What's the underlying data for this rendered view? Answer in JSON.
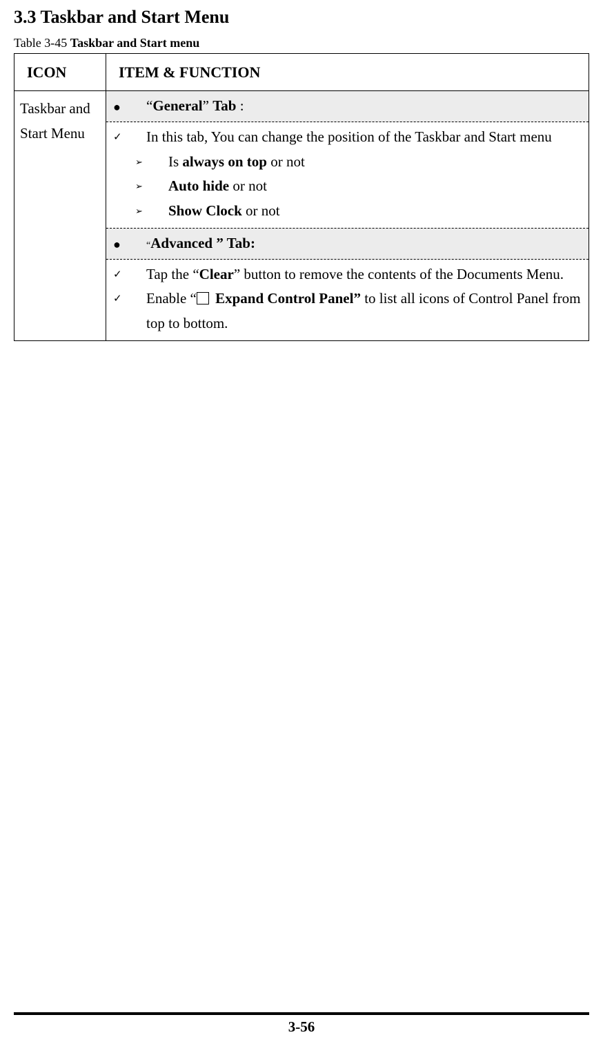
{
  "heading": "3.3 Taskbar and Start Menu",
  "caption_prefix": "Table 3-45 ",
  "caption_bold": "Taskbar and Start menu",
  "col1": "ICON",
  "col2": "ITEM & FUNCTION",
  "iconCell": "Taskbar and Start Menu",
  "tab1": {
    "q1": "“",
    "name": "General",
    "q2": "” ",
    "label": "Tab",
    "colon": " :",
    "body1": "In this tab, You can change the position of the Taskbar and Start menu",
    "s1a": "Is ",
    "s1b": "always on top",
    "s1c": " or not",
    "s2a": "Auto hide",
    "s2b": " or not",
    "s3a": "Show Clock",
    "s3b": " or not"
  },
  "tab2": {
    "q1": "“",
    "name": "Advanced ” Tab:",
    "b1a": "Tap the “",
    "b1b": "Clear",
    "b1c": "” button to remove the contents of the Documents Menu.",
    "b2a": "Enable “",
    "b2b": " Expand Control Panel",
    "b2c": "”",
    "b2d": "   to list all icons of Control Panel from top to bottom."
  },
  "page": "3-56"
}
